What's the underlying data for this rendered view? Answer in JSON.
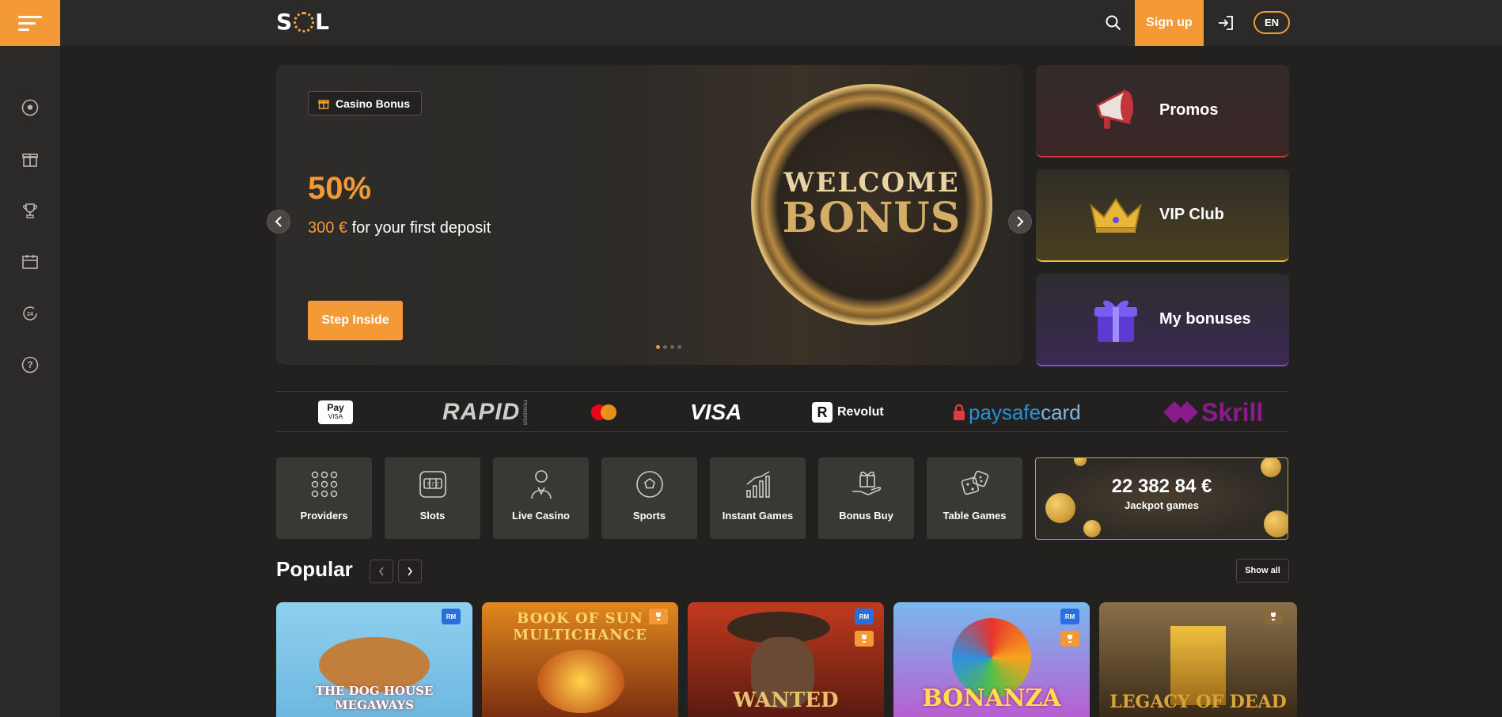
{
  "header": {
    "logo": "SOL",
    "signup_label": "Sign up",
    "lang": "EN"
  },
  "sidebar": {
    "items": [
      {
        "icon": "soccer-ball-icon"
      },
      {
        "icon": "gift-icon"
      },
      {
        "icon": "trophy-icon"
      },
      {
        "icon": "calendar-icon"
      },
      {
        "icon": "support-24-icon"
      },
      {
        "icon": "help-icon"
      }
    ]
  },
  "hero": {
    "badge": "Casino Bonus",
    "title": "50%",
    "amount": "300 €",
    "subtitle_rest": " for your first deposit",
    "cta": "Step Inside",
    "art_line1": "WELCOME",
    "art_line2": "BONUS",
    "slides": 4,
    "active_slide": 1
  },
  "tiles": {
    "promos": "Promos",
    "vip": "VIP Club",
    "bonuses": "My bonuses"
  },
  "payments": {
    "applepay": "Pay",
    "applepay_visa": "VISA",
    "rapid": "RAPID",
    "rapid_small": "TRANSFER",
    "visa": "VISA",
    "revolut": "Revolut",
    "paysafe_a": "paysafe",
    "paysafe_b": "card",
    "skrill": "Skrill"
  },
  "categories": [
    {
      "label": "Providers"
    },
    {
      "label": "Slots"
    },
    {
      "label": "Live Casino"
    },
    {
      "label": "Sports"
    },
    {
      "label": "Instant Games"
    },
    {
      "label": "Bonus Buy"
    },
    {
      "label": "Table Games"
    }
  ],
  "jackpot": {
    "amount": "22 382 84",
    "currency": "€",
    "label": "Jackpot games"
  },
  "popular": {
    "title": "Popular",
    "show_all": "Show all",
    "games": [
      {
        "title": "THE DOG HOUSE MEGAWAYS",
        "bg": "#8fd0ef"
      },
      {
        "title": "BOOK OF SUN MULTICHANCE",
        "bg": "#a8531a"
      },
      {
        "title": "WANTED",
        "bg": "#b8371e"
      },
      {
        "title": "BONANZA",
        "bg": "#6fb0e8"
      },
      {
        "title": "LEGACY OF DEAD",
        "bg": "#6b5532"
      }
    ],
    "badge_rm": "RM"
  },
  "colors": {
    "accent": "#f39a37",
    "bg": "#222120",
    "panel": "#2b2a28"
  }
}
